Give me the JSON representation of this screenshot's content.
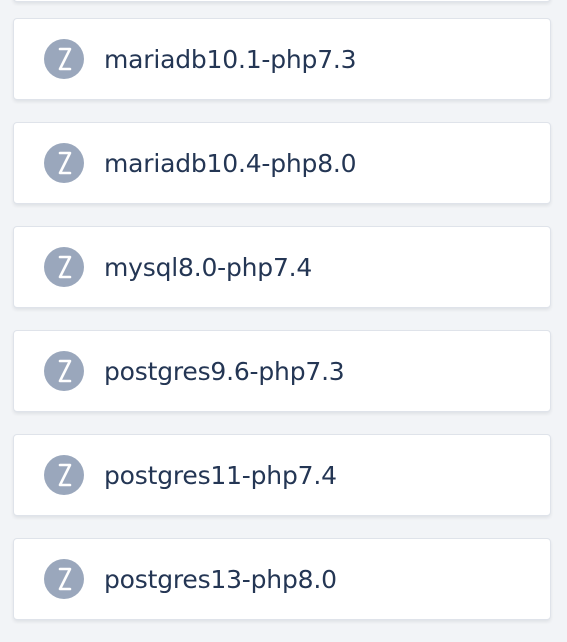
{
  "items": [
    {
      "label": "mariadb10.1-php7.3",
      "icon": "hourglass-icon"
    },
    {
      "label": "mariadb10.4-php8.0",
      "icon": "hourglass-icon"
    },
    {
      "label": "mysql8.0-php7.4",
      "icon": "hourglass-icon"
    },
    {
      "label": "postgres9.6-php7.3",
      "icon": "hourglass-icon"
    },
    {
      "label": "postgres11-php7.4",
      "icon": "hourglass-icon"
    },
    {
      "label": "postgres13-php8.0",
      "icon": "hourglass-icon"
    }
  ],
  "colors": {
    "background": "#f2f4f7",
    "card": "#ffffff",
    "card_border": "#dfe3ea",
    "icon_circle": "#9aa7bc",
    "icon_glyph": "#ffffff",
    "text": "#243654"
  }
}
